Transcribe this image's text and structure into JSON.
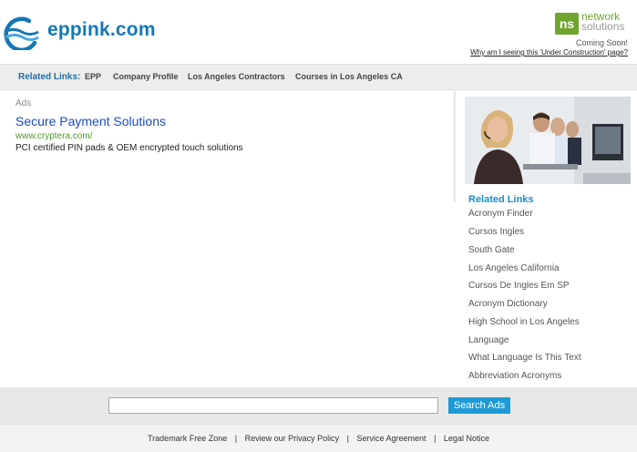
{
  "header": {
    "site_name": "eppink.com",
    "ns_logo_line1": "network",
    "ns_logo_line2": "solutions",
    "ns_box": "ns",
    "coming_soon": "Coming Soon!",
    "why_link": "Why am I seeing this 'Under Construction' page?"
  },
  "nav": {
    "title": "Related Links:",
    "items": [
      "EPP",
      "Company Profile",
      "Los Angeles Contractors",
      "Courses in Los Angeles CA"
    ]
  },
  "ads": {
    "label": "Ads",
    "title": "Secure Payment Solutions",
    "url": "www.cryptera.com/",
    "desc": "PCI certified PIN pads & OEM encrypted touch solutions"
  },
  "sidebar": {
    "title": "Related Links",
    "items": [
      "Acronym Finder",
      "Cursos Ingles",
      "South Gate",
      "Los Angeles California",
      "Cursos De Ingles Em SP",
      "Acronym Dictionary",
      "High School in Los Angeles",
      "Language",
      "What Language Is This Text",
      "Abbreviation Acronyms"
    ]
  },
  "search": {
    "placeholder": "",
    "button_label": "Search Ads"
  },
  "footer": {
    "links": [
      "Trademark Free Zone",
      "Review our Privacy Policy",
      "Service Agreement",
      "Legal Notice"
    ],
    "separator": "|"
  },
  "colors": {
    "brand_blue": "#1577b5",
    "ns_green": "#6fa52e",
    "ad_link": "#1a4cc9",
    "ad_url": "#4c9a2a",
    "search_button": "#1e9ad6"
  }
}
